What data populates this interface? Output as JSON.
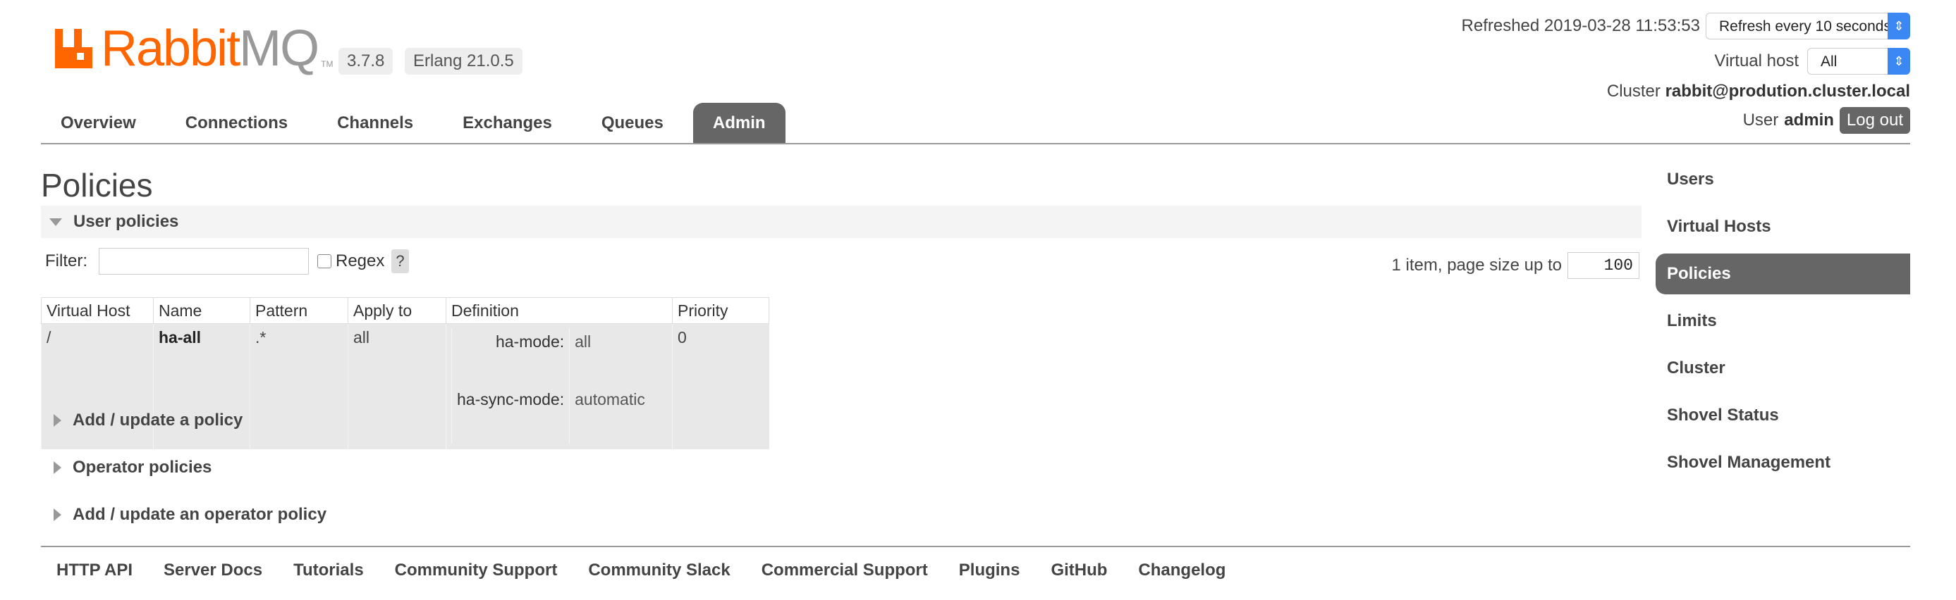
{
  "logo": {
    "brand_a": "Rabbit",
    "brand_b": "MQ",
    "trademark": "TM"
  },
  "versions": {
    "rabbitmq": "3.7.8",
    "erlang": "Erlang 21.0.5"
  },
  "header": {
    "refreshed_label": "Refreshed 2019-03-28 11:53:53",
    "refresh_select": "Refresh every 10 seconds",
    "virtual_host_label": "Virtual host",
    "virtual_host_select": "All",
    "cluster_label": "Cluster",
    "cluster_name": "rabbit@prodution.cluster.local",
    "user_label": "User",
    "user_name": "admin",
    "logout_label": "Log out"
  },
  "tabs": [
    {
      "label": "Overview"
    },
    {
      "label": "Connections"
    },
    {
      "label": "Channels"
    },
    {
      "label": "Exchanges"
    },
    {
      "label": "Queues"
    },
    {
      "label": "Admin",
      "active": true
    }
  ],
  "admin_menu": [
    {
      "label": "Users"
    },
    {
      "label": "Virtual Hosts"
    },
    {
      "label": "Policies",
      "active": true
    },
    {
      "label": "Limits"
    },
    {
      "label": "Cluster"
    },
    {
      "label": "Shovel Status"
    },
    {
      "label": "Shovel Management"
    }
  ],
  "page": {
    "title": "Policies",
    "section_title": "User policies",
    "filter_label": "Filter:",
    "filter_value": "",
    "regex_label": "Regex",
    "help_label": "?",
    "paging_text": "1 item, page size up to",
    "page_size": "100"
  },
  "table": {
    "headers": [
      "Virtual Host",
      "Name",
      "Pattern",
      "Apply to",
      "Definition",
      "Priority"
    ],
    "rows": [
      {
        "virtual_host": "/",
        "name": "ha-all",
        "pattern": ".*",
        "apply_to": "all",
        "definition": [
          {
            "key": "ha-mode:",
            "value": "all"
          },
          {
            "key": "ha-sync-mode:",
            "value": "automatic"
          }
        ],
        "priority": "0"
      }
    ]
  },
  "collapsibles": [
    {
      "label": "Add / update a policy"
    },
    {
      "label": "Operator policies"
    },
    {
      "label": "Add / update an operator policy"
    }
  ],
  "footer": [
    {
      "label": "HTTP API"
    },
    {
      "label": "Server Docs"
    },
    {
      "label": "Tutorials"
    },
    {
      "label": "Community Support"
    },
    {
      "label": "Community Slack"
    },
    {
      "label": "Commercial Support"
    },
    {
      "label": "Plugins"
    },
    {
      "label": "GitHub"
    },
    {
      "label": "Changelog"
    }
  ],
  "colors": {
    "brand_orange": "#ff6600",
    "tab_active": "#666666",
    "select_accent": "#3b88f5"
  },
  "icons": {
    "logo": "rabbitmq-logo-icon",
    "section_toggle": "triangle-down-icon",
    "collapsed_toggle": "triangle-right-icon",
    "select_arrows": "updown-arrows-icon"
  }
}
